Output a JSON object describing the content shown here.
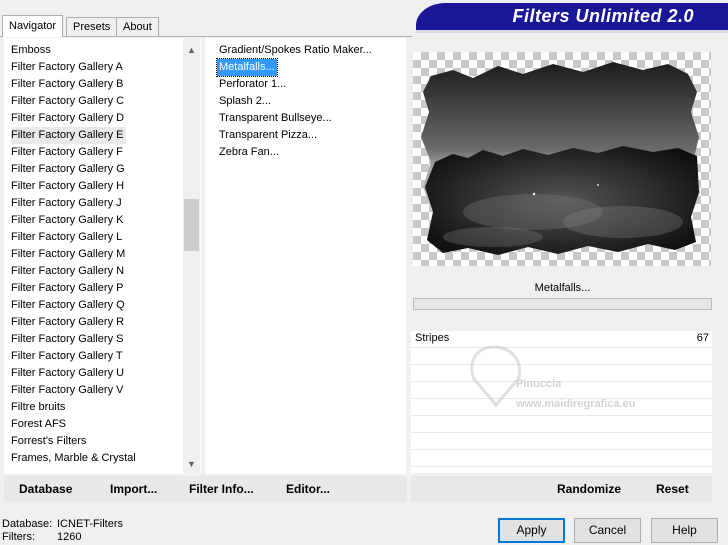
{
  "tabs": [
    {
      "label": "Navigator",
      "active": true
    },
    {
      "label": "Presets",
      "active": false
    },
    {
      "label": "About",
      "active": false
    }
  ],
  "banner": {
    "title": "Filters Unlimited 2.0"
  },
  "categories": {
    "selected": "Filter Factory Gallery E",
    "items": [
      "Emboss",
      "Filter Factory Gallery A",
      "Filter Factory Gallery B",
      "Filter Factory Gallery C",
      "Filter Factory Gallery D",
      "Filter Factory Gallery E",
      "Filter Factory Gallery F",
      "Filter Factory Gallery G",
      "Filter Factory Gallery H",
      "Filter Factory Gallery J",
      "Filter Factory Gallery K",
      "Filter Factory Gallery L",
      "Filter Factory Gallery M",
      "Filter Factory Gallery N",
      "Filter Factory Gallery P",
      "Filter Factory Gallery Q",
      "Filter Factory Gallery R",
      "Filter Factory Gallery S",
      "Filter Factory Gallery T",
      "Filter Factory Gallery U",
      "Filter Factory Gallery V",
      "Filtre bruits",
      "Forest AFS",
      "Forrest's Filters",
      "Frames, Marble & Crystal"
    ]
  },
  "filters": {
    "selected": "Metalfalls...",
    "items": [
      "Gradient/Spokes Ratio Maker...",
      "Metalfalls...",
      "Perforator 1...",
      "Splash 2...",
      "Transparent Bullseye...",
      "Transparent Pizza...",
      "Zebra Fan..."
    ]
  },
  "current_filter": "Metalfalls...",
  "params": [
    {
      "label": "Stripes",
      "value": "67"
    }
  ],
  "watermark": {
    "line1": "Pinuccia",
    "line2": "www.maidiregrafica.eu"
  },
  "toolbar": {
    "database": "Database",
    "import": "Import...",
    "filter_info": "Filter Info...",
    "editor": "Editor...",
    "randomize": "Randomize",
    "reset": "Reset"
  },
  "status": {
    "database_label": "Database:",
    "database_value": "ICNET-Filters",
    "filters_label": "Filters:",
    "filters_value": "1260"
  },
  "buttons": {
    "apply": "Apply",
    "cancel": "Cancel",
    "help": "Help"
  },
  "colors": {
    "banner": "#1a1796",
    "selection": "#3399ff",
    "accent": "#0078d7"
  },
  "icons": {
    "scroll_up": "▲",
    "scroll_down": "▼"
  }
}
